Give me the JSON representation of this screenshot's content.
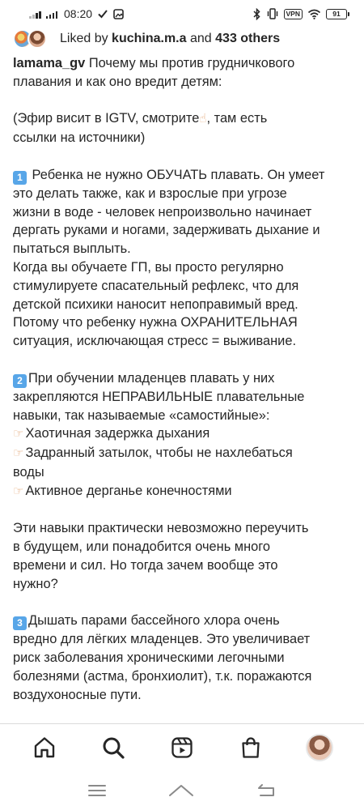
{
  "status_bar": {
    "time": "08:20",
    "vpn": "VPN",
    "battery": "91"
  },
  "likes": {
    "prefix": "Liked by",
    "user": "kuchina.m.a",
    "middle": "and",
    "others": "433 others"
  },
  "caption": {
    "username": "lamama_gv",
    "paragraphs": [
      {
        "lines": [
          {
            "username": true,
            "text": " Почему мы против грудничкового"
          },
          {
            "text": "плавания и как оно вредит детям:"
          }
        ]
      },
      {
        "lines": [
          {
            "text": "(Эфир висит в IGTV, смотрите",
            "emoji_after": "up",
            "after": ", там есть"
          },
          {
            "text": "ссылки на источники)"
          }
        ]
      },
      {
        "lines": [
          {
            "key": "1",
            "text": " Ребенка не нужно ОБУЧАТЬ плавать. Он умеет"
          },
          {
            "text": "это делать также, как и взрослые при угрозе"
          },
          {
            "text": "жизни в воде - человек непроизвольно начинает"
          },
          {
            "text": "дергать руками и ногами, задерживать дыхание и"
          },
          {
            "text": "пытаться выплыть."
          },
          {
            "text": "Когда вы обучаете ГП, вы просто регулярно"
          },
          {
            "text": "стимулируете спасательный рефлекс, что для"
          },
          {
            "text": "детской психики наносит непоправимый вред."
          },
          {
            "text": "Потому что ребенку нужна ОХРАНИТЕЛЬНАЯ"
          },
          {
            "text": "ситуация, исключающая стресс = выживание."
          }
        ]
      },
      {
        "lines": [
          {
            "key": "2",
            "text": "При обучении младенцев плавать у них"
          },
          {
            "text": "закрепляются НЕПРАВИЛЬНЫЕ плавательные"
          },
          {
            "text": "навыки, так называемые «самостийные»:"
          },
          {
            "hand": true,
            "text": "Хаотичная задержка дыхания"
          },
          {
            "hand": true,
            "text": "Задранный затылок, чтобы не нахлебаться"
          },
          {
            "text": "воды"
          },
          {
            "hand": true,
            "text": "Активное дерганье конечностями"
          }
        ]
      },
      {
        "lines": [
          {
            "text": "Эти навыки практически невозможно переучить"
          },
          {
            "text": "в будущем, или понадобится очень много"
          },
          {
            "text": "времени и сил. Но тогда зачем вообще это"
          },
          {
            "text": "нужно?"
          }
        ]
      },
      {
        "lines": [
          {
            "key": "3",
            "text": "Дышать парами бассейного хлора очень"
          },
          {
            "text": "вредно для лёгких младенцев. Это увеличивает"
          },
          {
            "text": "риск заболевания хроническими легочными"
          },
          {
            "text": "болезнями (астма, бронхиолит), т.к. поражаются"
          },
          {
            "text": "воздухоносные пути."
          }
        ]
      }
    ]
  },
  "bottom_nav": {
    "items": [
      "home-icon",
      "search-icon",
      "reels-icon",
      "shop-icon",
      "profile-avatar"
    ]
  },
  "system_nav": {
    "items": [
      "menu-icon",
      "home-icon",
      "back-icon"
    ]
  },
  "colors": {
    "text": "#262626",
    "divider": "#dbdbdb",
    "keycap": "#58a6e8",
    "hand": "#e8b48a"
  }
}
